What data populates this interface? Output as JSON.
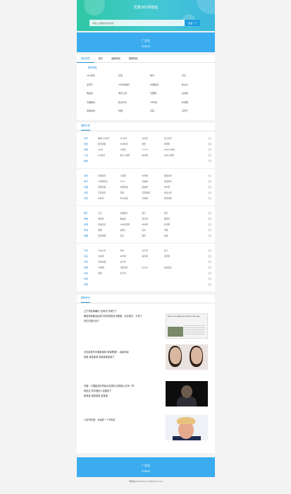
{
  "header": {
    "site_title": "优惠365导航站",
    "search_placeholder": "请输入您要搜索的内容",
    "search_button": "百度一下"
  },
  "ad_top": {
    "title": "广告位",
    "code": "R2D00"
  },
  "tabs": [
    "网址导航",
    "音乐",
    "最新网站",
    "推荐网站"
  ],
  "famous_title": "推荐导航",
  "famous_sites": [
    [
      "360搜索",
      "百度",
      "腾讯",
      "京东"
    ],
    [
      "爱奇艺",
      "58同城便利",
      "中国移动",
      "焦点点"
    ],
    [
      "唯品会",
      "电影之家",
      "优酷网",
      "爱淘宝"
    ],
    [
      "天猫精选",
      "起点中文",
      "58同城",
      "新浪网"
    ],
    [
      "搜狐新闻",
      "优酷",
      "百度",
      "爱奇艺"
    ]
  ],
  "category_section_title": "推荐分类",
  "category_blocks": [
    [
      {
        "name": "音乐",
        "links": [
          "酷狗 QQ音乐",
          "QQ空间",
          "DJ音乐",
          "贝壳音乐",
          ""
        ]
      },
      {
        "name": "影视",
        "links": [
          "腾讯视频",
          "360影视",
          "电影",
          "影视网",
          ""
        ]
      },
      {
        "name": "游戏",
        "links": [
          "4399",
          "小游戏",
          "17173",
          "4399小游戏",
          ""
        ]
      },
      {
        "name": "小说",
        "links": [
          "QQ阅读",
          "起点小说吧",
          "看书网",
          "全本小说网",
          ""
        ]
      },
      {
        "name": "邮箱",
        "links": [
          "",
          "",
          "",
          "",
          ""
        ]
      }
    ],
    [
      {
        "name": "新闻",
        "links": [
          "凤凰新闻",
          "人民网",
          "中华网",
          "凤凰资讯",
          ""
        ]
      },
      {
        "name": "体育",
        "links": [
          "人民网体育",
          "CCTV",
          "直播吧",
          "新浪体育",
          ""
        ]
      },
      {
        "name": "军事",
        "links": [
          "凤凰军事",
          "中国军事",
          "铁血网",
          "米尔网",
          ""
        ]
      },
      {
        "name": "社区",
        "links": [
          "天涯社区",
          "豆瓣",
          "百度贴吧",
          "新浪论坛",
          ""
        ]
      },
      {
        "name": "手机",
        "links": [
          "中关村",
          "华为商城",
          "手机网",
          "苹果官网",
          ""
        ]
      }
    ],
    [
      {
        "name": "银行",
        "links": [
          "工商",
          "中国银行",
          "建行",
          "招行",
          ""
        ]
      },
      {
        "name": "购物",
        "links": [
          "聚划算",
          "唯品会",
          "亚马逊",
          "蘑菇街",
          ""
        ]
      },
      {
        "name": "彩票",
        "links": [
          "新浪彩票",
          "500彩票网",
          "中彩网",
          "彩票网",
          ""
        ]
      },
      {
        "name": "旅游",
        "links": [
          "携程",
          "去哪儿",
          "途牛",
          "同程",
          ""
        ]
      },
      {
        "name": "地图",
        "links": [
          "百度地图",
          "高德",
          "腾讯",
          "谷歌",
          ""
        ]
      }
    ],
    [
      {
        "name": "汽车",
        "links": [
          "汽车之家",
          "易车",
          "太平洋",
          "爱卡",
          ""
        ]
      },
      {
        "name": "考试",
        "links": [
          "考试网",
          "中华网",
          "教育网",
          "学历网",
          ""
        ]
      },
      {
        "name": "手机",
        "links": [
          "手机中国",
          "太平洋",
          "",
          "",
          ""
        ]
      },
      {
        "name": "健康",
        "links": [
          "39健康",
          "寻医问药",
          "好大夫",
          "家庭医生",
          ""
        ]
      },
      {
        "name": "女性",
        "links": [
          "瑞丽",
          "太平洋",
          "",
          "",
          ""
        ]
      },
      {
        "name": "科技",
        "links": [
          "",
          "",
          "",
          "",
          ""
        ]
      },
      {
        "name": "游戏",
        "links": [
          "",
          "",
          "",
          "",
          ""
        ]
      }
    ]
  ],
  "more_label": "更多",
  "news_section_title": "推荐资讯",
  "news": [
    {
      "lines": [
        "辽宁号航母编队“反转式”训练了？",
        "解放军南部战区首次发布新型对手舰舶，对比美日：又来了",
        "你们中国又来了"
      ],
      "thumb_text": "Carrier & destroyer take to the sea, "
    },
    {
      "lines": [
        "司法部发布中国某某和“新闻联播”…最新消息",
        "某某 某某某某 某某某某某某了"
      ],
      "thumb_text": ""
    },
    {
      "lines": [
        "外媒：中国建成世界最大高铁网 高铁看公交车一样",
        "网友这 刻中国这么全都是了",
        "新某某 某某某某 某某某"
      ],
      "thumb_text": ""
    },
    {
      "lines": [
        "人民币贬值：大幅新一个平衡位"
      ],
      "thumb_text": ""
    }
  ],
  "ad_bottom": {
    "title": "广告位",
    "code": "R2D00"
  },
  "footer": "导航站 Powered by YouNet3 V1.0.0"
}
